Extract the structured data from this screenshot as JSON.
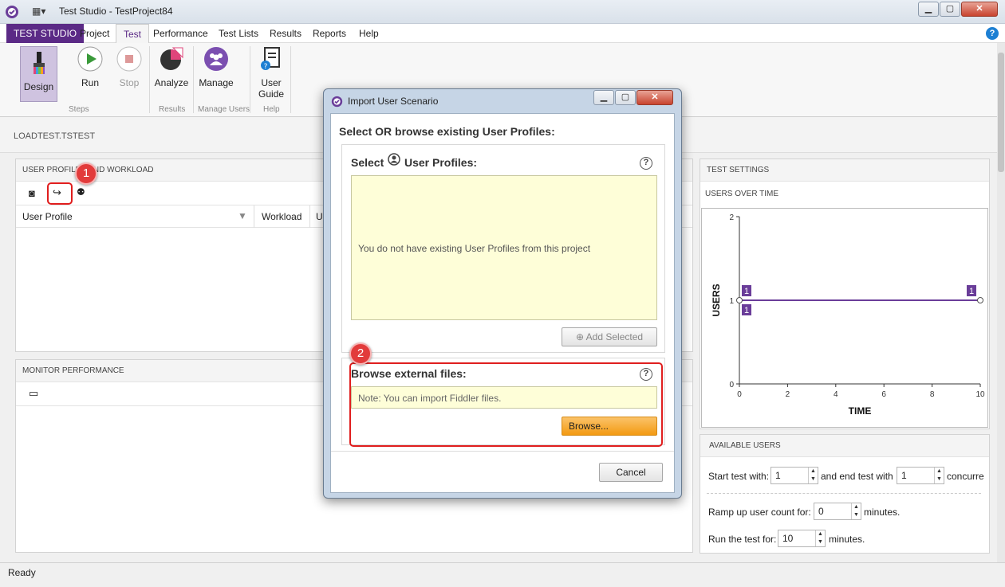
{
  "window": {
    "title": "Test Studio - TestProject84",
    "controls": [
      "minimize",
      "maximize",
      "close"
    ]
  },
  "menu": {
    "brand": "TEST STUDIO",
    "items": [
      "Project",
      "Test",
      "Performance",
      "Test Lists",
      "Results",
      "Reports",
      "Help"
    ],
    "active": "Test",
    "help_icon": "?"
  },
  "ribbon": {
    "design": "Design",
    "run": "Run",
    "stop": "Stop",
    "steps_group": "Steps",
    "analyze": "Analyze",
    "results_group": "Results",
    "manage": "Manage",
    "manage_group": "Manage Users",
    "user_guide_line1": "User",
    "user_guide_line2": "Guide",
    "help_group": "Help"
  },
  "breadcrumb": "LOADTEST.TSTEST",
  "profiles_panel": {
    "header": "USER PROFILES AND WORKLOAD",
    "col_user_profile": "User Profile",
    "col_workload": "Workload",
    "col_partial": "U"
  },
  "monitor_panel": {
    "header": "MONITOR PERFORMANCE"
  },
  "callouts": {
    "one": "1",
    "two": "2"
  },
  "dialog": {
    "title": "Import User Scenario",
    "heading": "Select OR browse existing User Profiles:",
    "select_label_pre": "Select",
    "select_label_post": "User Profiles:",
    "empty_message": "You do not have existing User Profiles from this project",
    "add_selected": "Add Selected",
    "browse_label": "Browse external files:",
    "note": "Note: You can import Fiddler files.",
    "browse_button": "Browse...",
    "cancel_button": "Cancel",
    "help_q": "?"
  },
  "test_settings": {
    "header": "TEST SETTINGS",
    "subheader": "USERS OVER TIME"
  },
  "chart_data": {
    "type": "line",
    "title": "",
    "xlabel": "TIME",
    "ylabel": "USERS",
    "xlim": [
      0,
      10
    ],
    "ylim": [
      0,
      2
    ],
    "x_ticks": [
      "0",
      "2",
      "4",
      "6",
      "8",
      "10"
    ],
    "y_ticks": [
      "0",
      "1",
      "2"
    ],
    "series": [
      {
        "x": [
          0,
          10
        ],
        "y": [
          1,
          1
        ]
      }
    ],
    "annotations": [
      {
        "x": 0,
        "y": 1,
        "label": "1",
        "pos": "above"
      },
      {
        "x": 0,
        "y": 1,
        "label": "1",
        "pos": "below"
      },
      {
        "x": 10,
        "y": 1,
        "label": "1",
        "pos": "above"
      }
    ]
  },
  "available_users": {
    "header": "AVAILABLE USERS",
    "start_label": "Start test with:",
    "start_value": "1",
    "end_label": "and end test with",
    "end_value": "1",
    "concurrent_label": "concurre",
    "ramp_label": "Ramp up user count for:",
    "ramp_value": "0",
    "ramp_units": "minutes.",
    "run_label": "Run the test for:",
    "run_value": "10",
    "run_units": "minutes."
  },
  "status": "Ready",
  "colors": {
    "brand": "#5b2a86",
    "accent_orange": "#f6a21e",
    "callout_red": "#e01e1e",
    "series": "#6a3d99"
  }
}
